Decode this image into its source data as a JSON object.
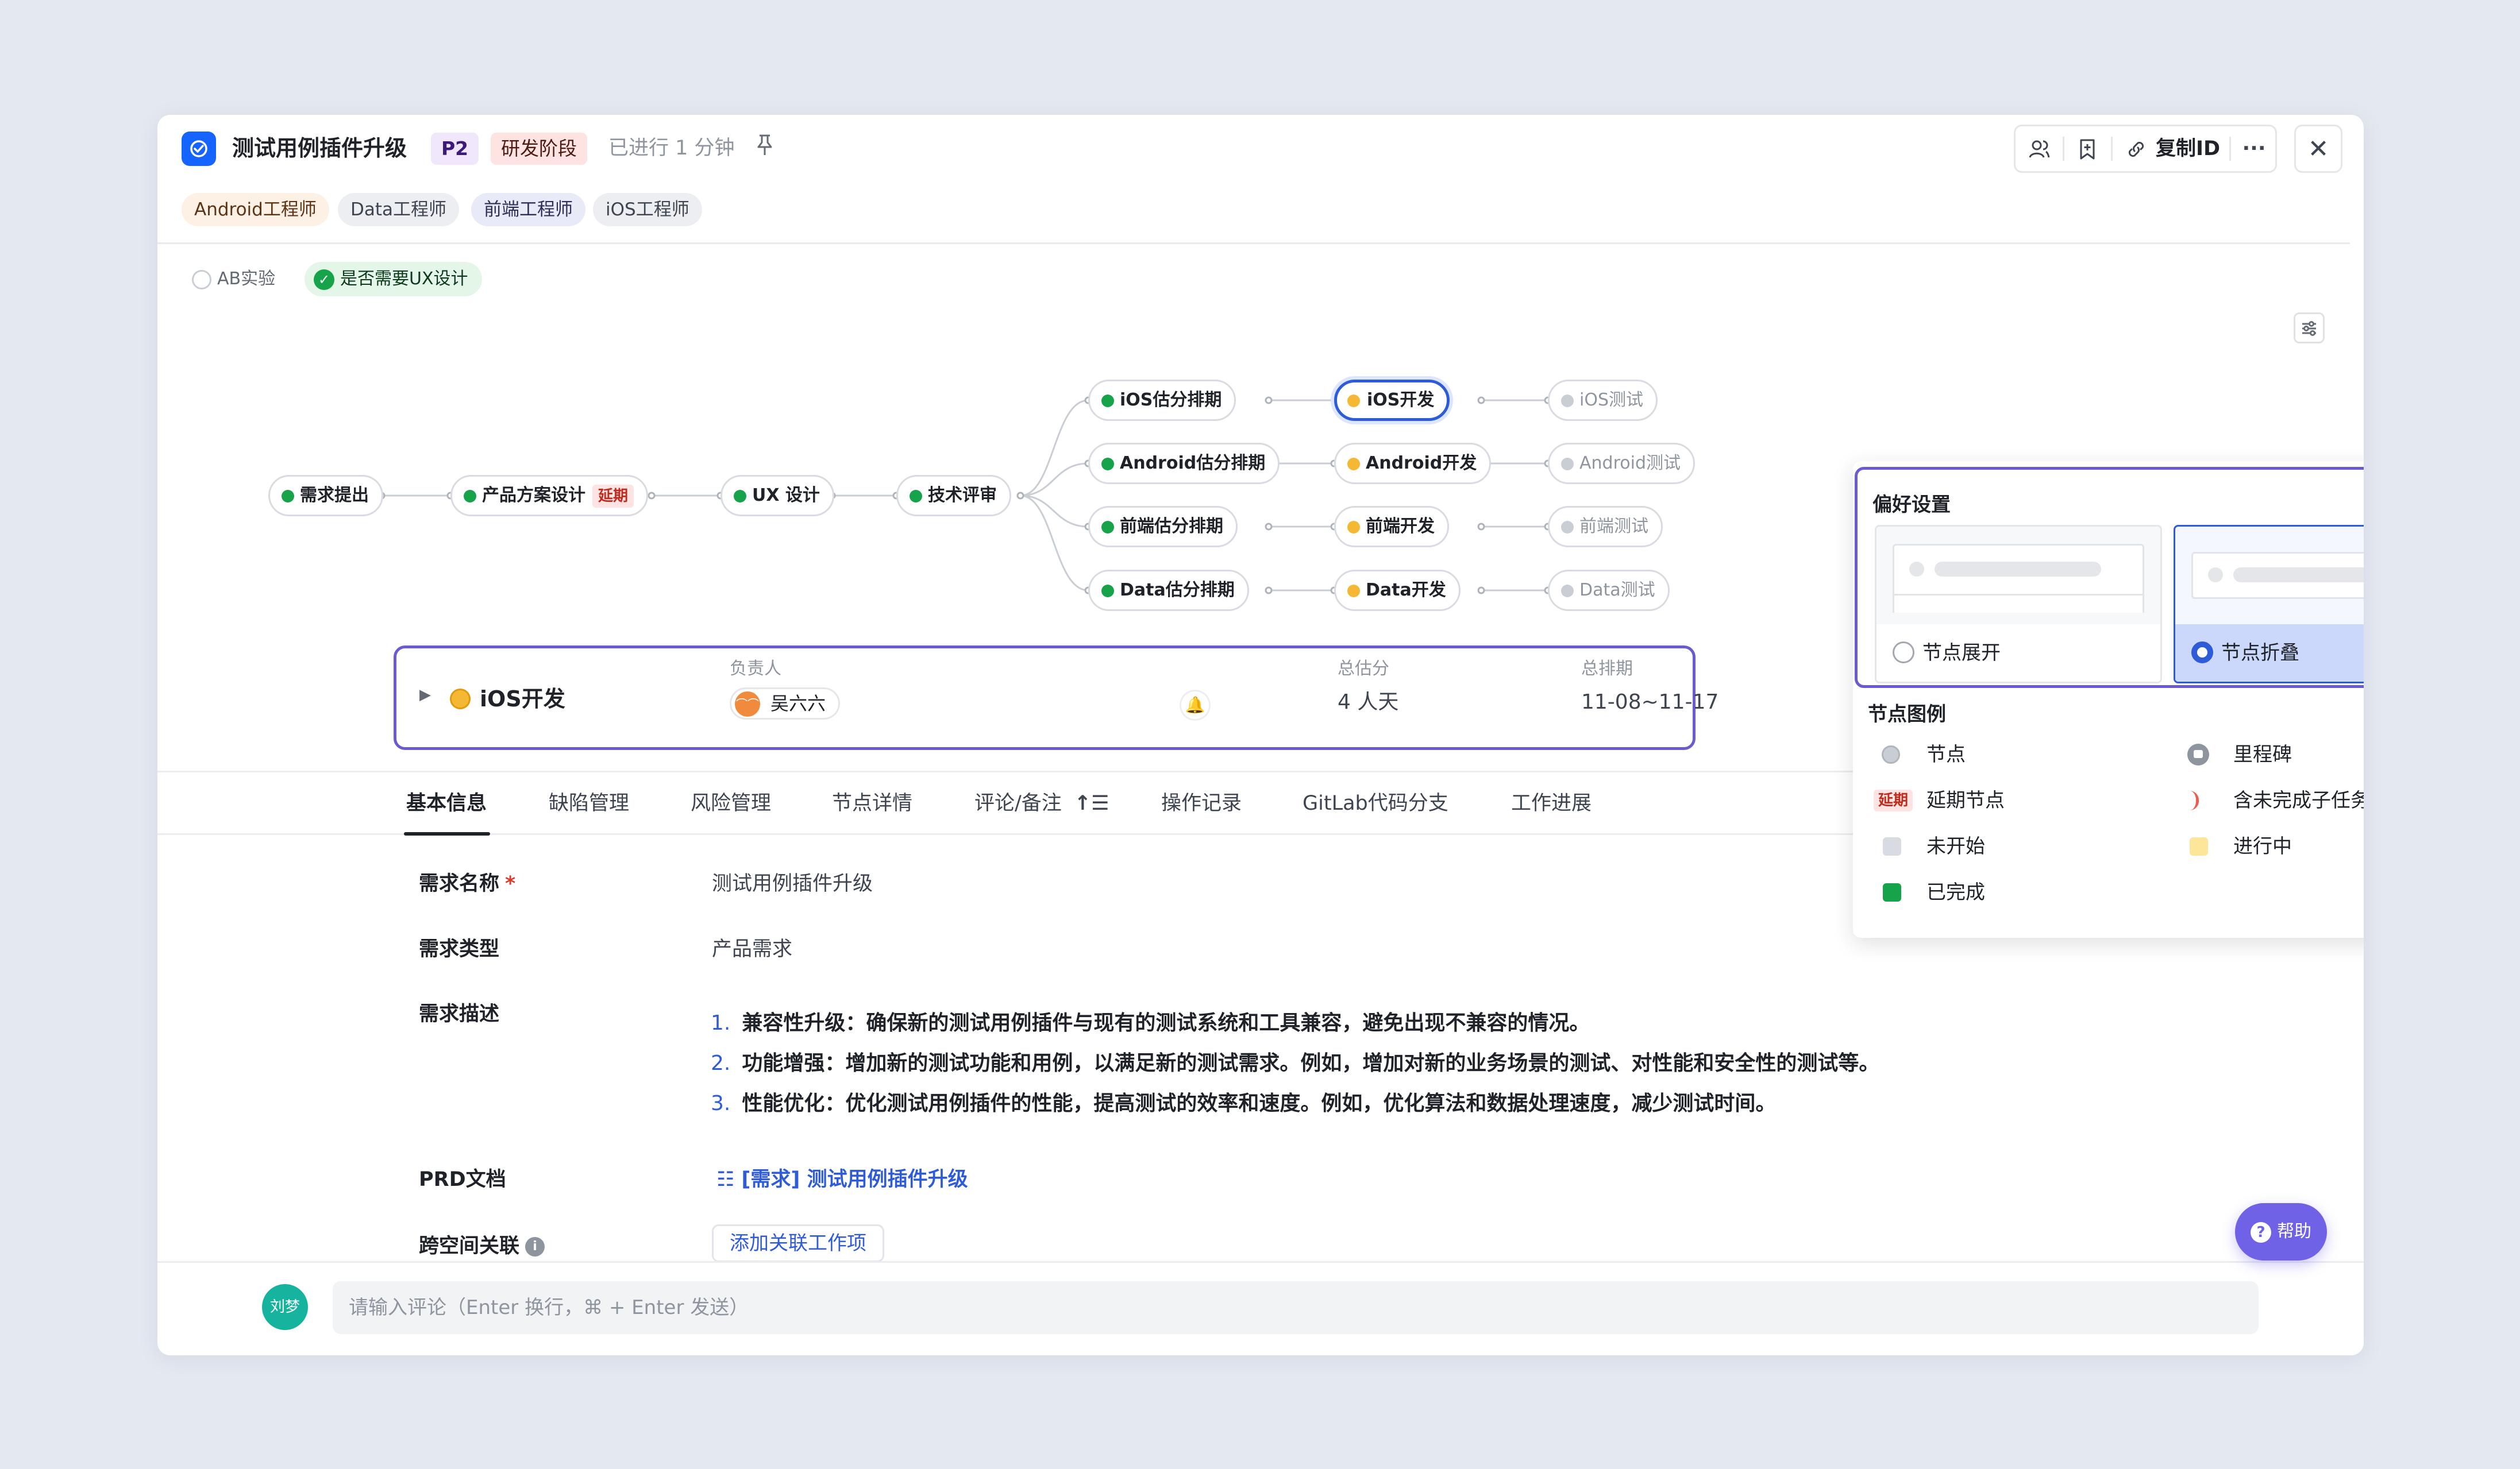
{
  "header": {
    "title": "测试用例插件升级",
    "priority": "P2",
    "stage": "研发阶段",
    "elapsed": "已进行 1 分钟",
    "copy_id_label": "复制ID"
  },
  "roles": [
    "Android工程师",
    "Data工程师",
    "前端工程师",
    "iOS工程师"
  ],
  "options": {
    "ab_test": "AB实验",
    "ux_design": "是否需要UX设计"
  },
  "flow": {
    "main": [
      {
        "label": "需求提出",
        "status": "done"
      },
      {
        "label": "产品方案设计",
        "status": "done",
        "tag": "延期"
      },
      {
        "label": "UX 设计",
        "status": "done"
      },
      {
        "label": "技术评审",
        "status": "done"
      }
    ],
    "estimate": [
      "iOS估分排期",
      "Android估分排期",
      "前端估分排期",
      "Data估分排期"
    ],
    "develop": [
      "iOS开发",
      "Android开发",
      "前端开发",
      "Data开发"
    ],
    "test": [
      "iOS测试",
      "Android测试",
      "前端测试",
      "Data测试"
    ]
  },
  "detail": {
    "name": "iOS开发",
    "owner_label": "负责人",
    "owner": "吴六六",
    "estimate_label": "总估分",
    "estimate": "4 人天",
    "schedule_label": "总排期",
    "schedule": "11-08~11-17"
  },
  "tabs": [
    "基本信息",
    "缺陷管理",
    "风险管理",
    "节点详情",
    "评论/备注",
    "操作记录",
    "GitLab代码分支",
    "工作进展"
  ],
  "form": {
    "name_label": "需求名称",
    "name_value": "测试用例插件升级",
    "type_label": "需求类型",
    "type_value": "产品需求",
    "desc_label": "需求描述",
    "desc_items": [
      "兼容性升级：确保新的测试用例插件与现有的测试系统和工具兼容，避免出现不兼容的情况。",
      "功能增强：增加新的测试功能和用例，以满足新的测试需求。例如，增加对新的业务场景的测试、对性能和安全性的测试等。",
      "性能优化：优化测试用例插件的性能，提高测试的效率和速度。例如，优化算法和数据处理速度，减少测试时间。"
    ],
    "prd_label": "PRD文档",
    "prd_link": "[需求] 测试用例插件升级",
    "cross_label": "跨空间关联",
    "add_link_button": "添加关联工作项"
  },
  "comment": {
    "avatar": "刘梦",
    "placeholder": "请输入评论（Enter 换行，⌘ + Enter 发送）"
  },
  "help_label": "帮助",
  "preferences": {
    "title": "偏好设置",
    "expand_label": "节点展开",
    "collapse_label": "节点折叠",
    "selected": "collapse",
    "legend_title": "节点图例",
    "legend": {
      "node": "节点",
      "milestone": "里程碑",
      "delayed_tag": "延期",
      "delayed": "延期节点",
      "unfinished_subtask": "含未完成子任务",
      "not_started": "未开始",
      "in_progress": "进行中",
      "completed": "已完成"
    }
  },
  "colors": {
    "accent": "#2e5bd8",
    "done": "#16a34a",
    "in_progress": "#f5b833",
    "not_started": "#c9cdd4",
    "delay": "#c02b1e",
    "help": "#7062e6"
  }
}
